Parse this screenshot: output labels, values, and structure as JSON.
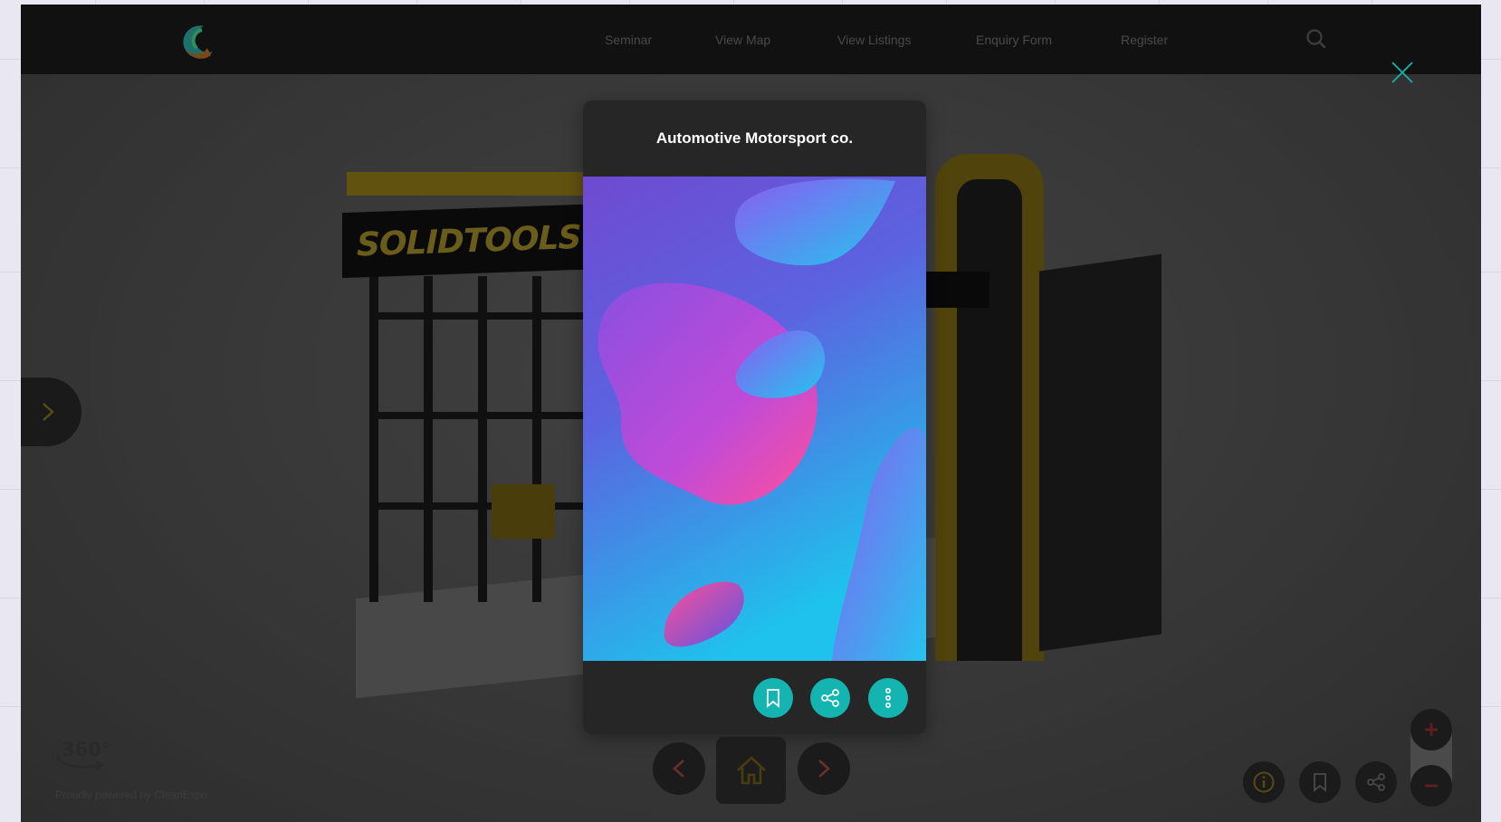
{
  "nav": {
    "items": [
      {
        "label": "Seminar"
      },
      {
        "label": "View Map"
      },
      {
        "label": "View Listings"
      },
      {
        "label": "Enquiry Form"
      },
      {
        "label": "Register"
      }
    ],
    "logo_icon": "crescent-logo-icon",
    "search_icon": "search-icon"
  },
  "booth": {
    "sign_text": "SOLIDTOOLS"
  },
  "modal": {
    "title": "Automotive Motorsport co.",
    "actions": [
      {
        "icon": "bookmark-icon"
      },
      {
        "icon": "share-icon"
      },
      {
        "icon": "more-vertical-icon"
      }
    ]
  },
  "footer": {
    "badge": "360°",
    "powered_by": "Proudly powered by CleanExpo"
  },
  "colors": {
    "accent": "#14b4b0",
    "topbar": "#111111",
    "modal_bg": "#262626",
    "close": "#14b4b0"
  }
}
